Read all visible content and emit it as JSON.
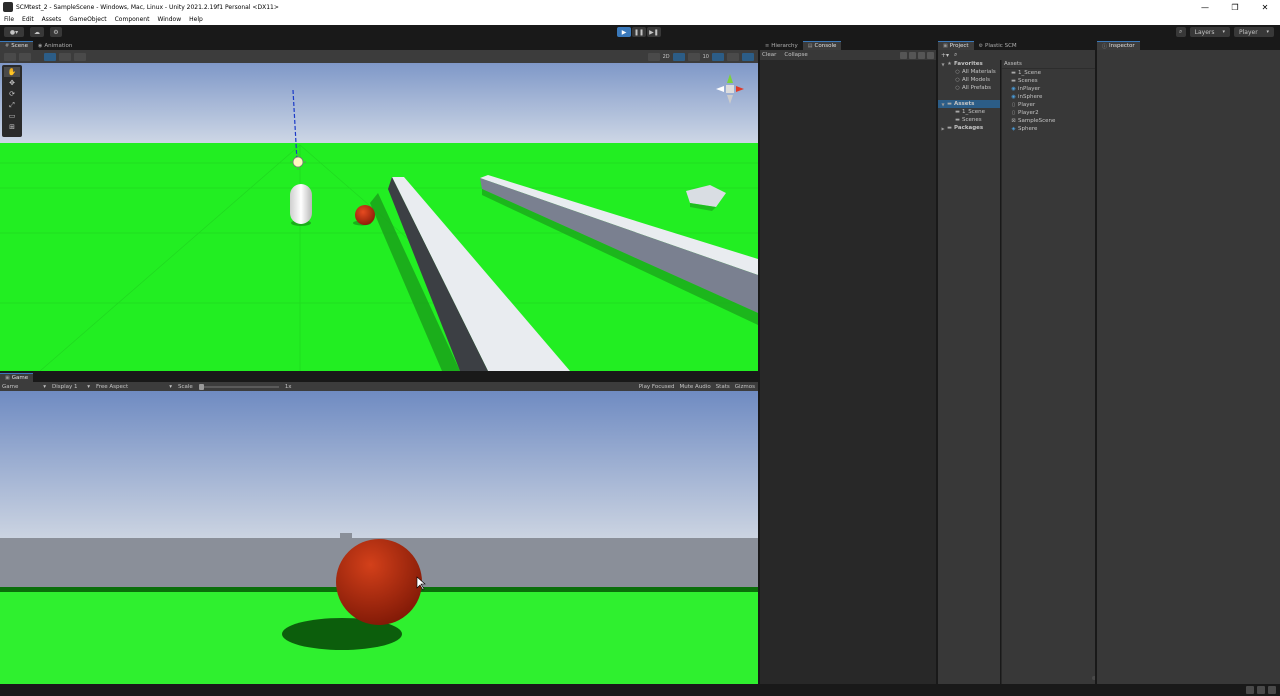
{
  "window": {
    "title": "SCMtest_2 - SampleScene - Windows, Mac, Linux - Unity 2021.2.19f1 Personal <DX11>",
    "controls": [
      "—",
      "❐",
      "✕"
    ]
  },
  "menu": [
    "File",
    "Edit",
    "Assets",
    "GameObject",
    "Component",
    "Window",
    "Help"
  ],
  "toolbar": {
    "play_icons": [
      "▶",
      "❚❚",
      "▶❚"
    ],
    "layers_label": "Layers",
    "layout_label": "Player"
  },
  "scene_panel": {
    "tabs": [
      {
        "label": "Scene",
        "icon": "#"
      },
      {
        "label": "Animation",
        "icon": "◉"
      }
    ],
    "toolbar_right": {
      "draw_mode": "2D",
      "num": "10"
    },
    "tools": [
      "✋",
      "✥",
      "⟳",
      "⤢",
      "▭",
      "⊞"
    ]
  },
  "game_panel": {
    "tab": {
      "label": "Game",
      "icon": "▣"
    },
    "display_mode": "Game",
    "display": "Display 1",
    "aspect": "Free Aspect",
    "scale_label": "Scale",
    "scale_value": "1x",
    "right": [
      "Play Focused",
      "Mute Audio",
      "Stats",
      "Gizmos"
    ]
  },
  "hierarchy": {
    "tabs": [
      {
        "label": "Hierarchy",
        "icon": "≡"
      },
      {
        "label": "Console",
        "icon": "▤"
      }
    ],
    "tools": [
      "Clear",
      "Collapse"
    ]
  },
  "project": {
    "tabs": [
      {
        "label": "Project",
        "icon": "▣"
      },
      {
        "label": "Plastic SCM",
        "icon": "⚙"
      }
    ],
    "tree": [
      {
        "label": "Favorites",
        "level": 0,
        "arrow": "▼",
        "icon": "★",
        "bold": true,
        "selected": false
      },
      {
        "label": "All Materials",
        "level": 1,
        "arrow": "",
        "icon": "○",
        "bold": false,
        "selected": false
      },
      {
        "label": "All Models",
        "level": 1,
        "arrow": "",
        "icon": "○",
        "bold": false,
        "selected": false
      },
      {
        "label": "All Prefabs",
        "level": 1,
        "arrow": "",
        "icon": "○",
        "bold": false,
        "selected": false
      },
      {
        "label": "",
        "level": 0,
        "arrow": "",
        "icon": "",
        "bold": false,
        "selected": false
      },
      {
        "label": "Assets",
        "level": 0,
        "arrow": "▼",
        "icon": "▬",
        "bold": true,
        "selected": true
      },
      {
        "label": "1_Scene",
        "level": 1,
        "arrow": "",
        "icon": "▬",
        "bold": false,
        "selected": false
      },
      {
        "label": "Scenes",
        "level": 1,
        "arrow": "",
        "icon": "▬",
        "bold": false,
        "selected": false
      },
      {
        "label": "Packages",
        "level": 0,
        "arrow": "▶",
        "icon": "▬",
        "bold": true,
        "selected": false
      }
    ],
    "assets_header": "Assets",
    "assets": [
      {
        "label": "1_Scene",
        "icon": "▬"
      },
      {
        "label": "Scenes",
        "icon": "▬"
      },
      {
        "label": "inPlayer",
        "icon": "◉"
      },
      {
        "label": "inSphere",
        "icon": "◉"
      },
      {
        "label": "Player",
        "icon": "▯"
      },
      {
        "label": "Player2",
        "icon": "▯"
      },
      {
        "label": "SampleScene",
        "icon": "⊠"
      },
      {
        "label": "Sphere",
        "icon": "◈"
      }
    ]
  },
  "inspector": {
    "tab": {
      "label": "Inspector",
      "icon": "ⓘ"
    }
  },
  "colors": {
    "ground": "#22ee22",
    "sky_top": "#7f98c8",
    "sphere": "#c0300f",
    "wall": "#8a8f99",
    "accent": "#3a79bb"
  }
}
